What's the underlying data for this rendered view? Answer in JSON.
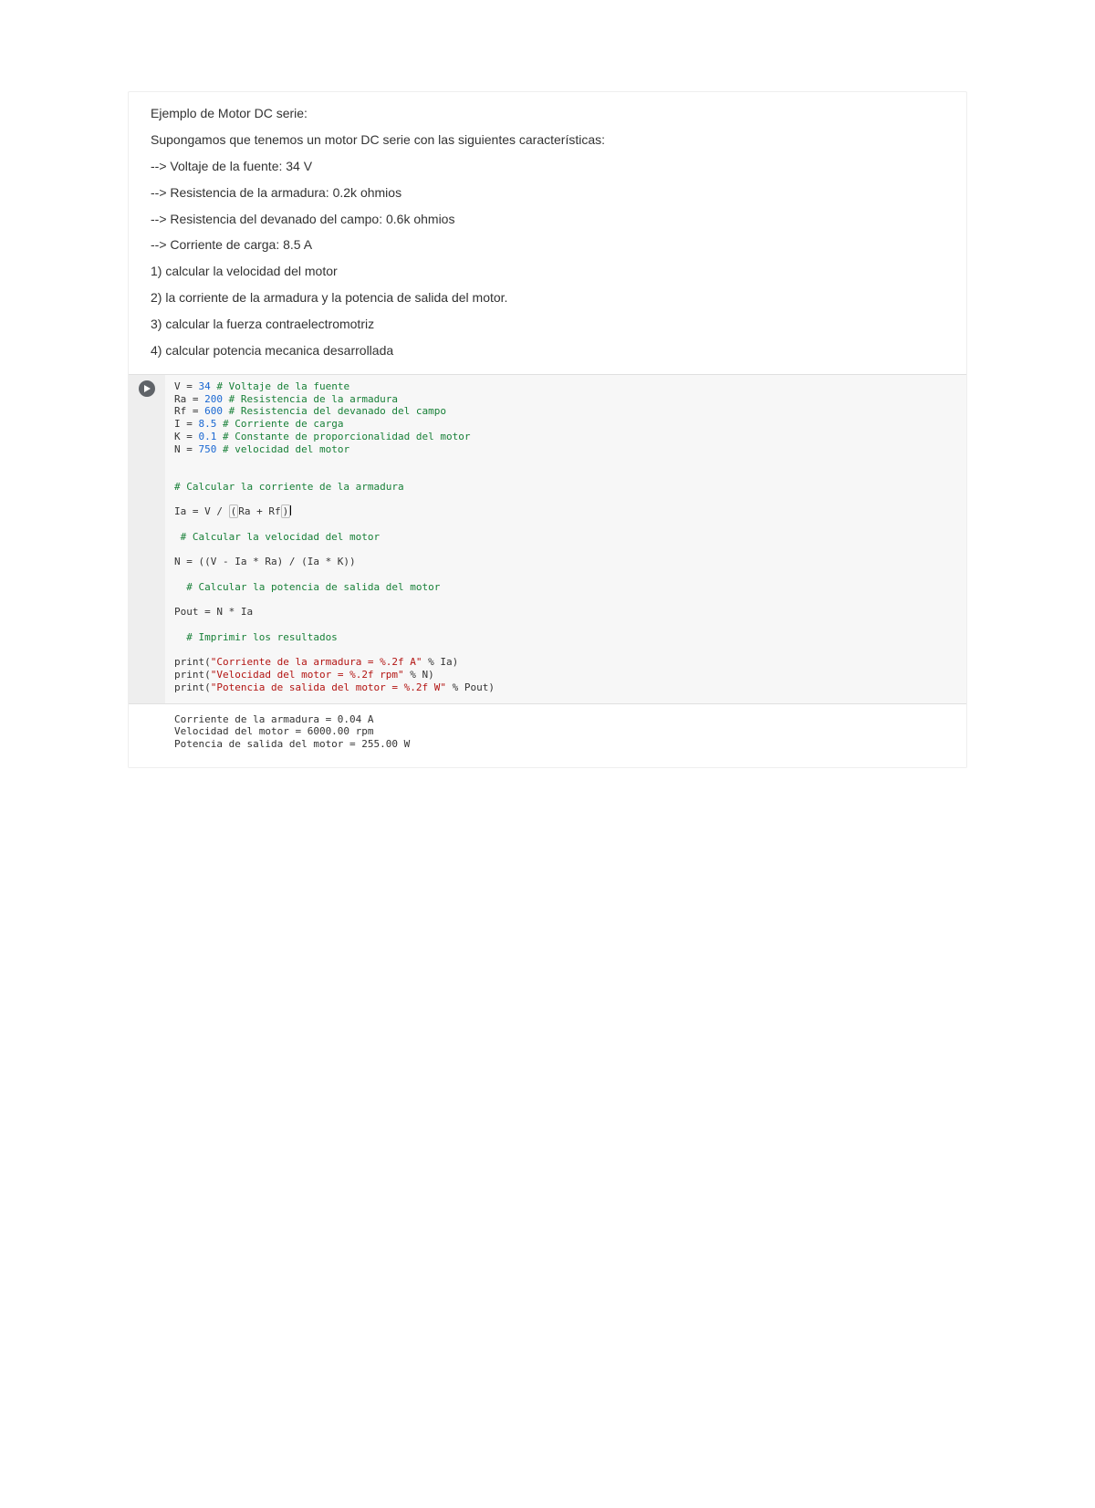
{
  "markdown": {
    "lines": [
      "Ejemplo de Motor DC serie:",
      "Supongamos que tenemos un motor DC serie con las siguientes características:",
      "--> Voltaje de la fuente: 34 V",
      "--> Resistencia de la armadura: 0.2k ohmios",
      "--> Resistencia del devanado del campo: 0.6k ohmios",
      "--> Corriente de carga: 8.5 A",
      "1) calcular la velocidad del motor",
      "2) la corriente de la armadura y la potencia de salida del motor.",
      "3) calcular la fuerza contraelectromotriz",
      "4) calcular potencia mecanica desarrollada"
    ]
  },
  "code": {
    "l1a": "V = ",
    "l1n": "34",
    "l1c": " # Voltaje de la fuente",
    "l2a": "Ra = ",
    "l2n": "200",
    "l2c": " # Resistencia de la armadura",
    "l3a": "Rf = ",
    "l3n": "600",
    "l3c": " # Resistencia del devanado del campo",
    "l4a": "I = ",
    "l4n": "8.5",
    "l4c": " # Corriente de carga",
    "l5a": "K = ",
    "l5n": "0.1",
    "l5c": " # Constante de proporcionalidad del motor",
    "l6a": "N = ",
    "l6n": "750",
    "l6c": " # velocidad del motor",
    "blank": "",
    "l8c": "# Calcular la corriente de la armadura",
    "l9a": "Ia = V / ",
    "l9b": "(",
    "l9mid": "Ra + Rf",
    "l9c": ")",
    "l10c": " # Calcular la velocidad del motor",
    "l11": "N = ((V - Ia * Ra) / (Ia * K))",
    "l12c": "  # Calcular la potencia de salida del motor",
    "l13": "Pout = N * Ia",
    "l14c": "  # Imprimir los resultados",
    "l15a": "print(",
    "l15s": "\"Corriente de la armadura = %.2f A\"",
    "l15b": " % Ia)",
    "l16a": "print(",
    "l16s": "\"Velocidad del motor = %.2f rpm\"",
    "l16b": " % N)",
    "l17a": "print(",
    "l17s": "\"Potencia de salida del motor = %.2f W\"",
    "l17b": " % Pout)"
  },
  "output": {
    "l1": "Corriente de la armadura = 0.04 A",
    "l2": "Velocidad del motor = 6000.00 rpm",
    "l3": "Potencia de salida del motor = 255.00 W"
  }
}
